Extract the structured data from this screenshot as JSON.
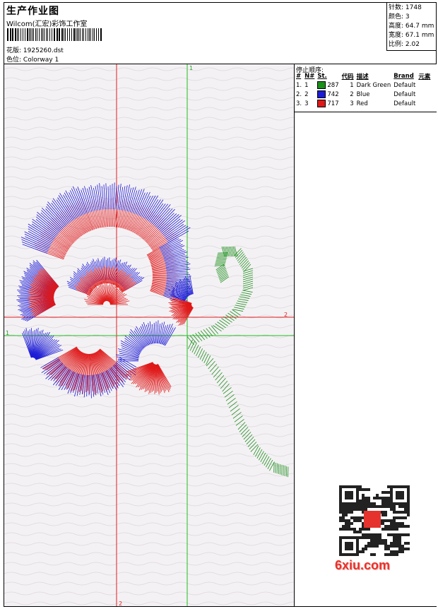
{
  "header": {
    "title": "生产作业图",
    "company": "Wilcom(汇宏)彩饰工作室",
    "pattern_label": "花版:",
    "pattern_value": "1925260.dst",
    "color_label": "色位:",
    "color_value": "Colorway 1"
  },
  "stats": [
    {
      "label": "针数:",
      "value": "1748"
    },
    {
      "label": "颜色:",
      "value": "3"
    },
    {
      "label": "高度:",
      "value": "64.7 mm"
    },
    {
      "label": "宽度:",
      "value": "67.1 mm"
    },
    {
      "label": "比例:",
      "value": "2.02"
    }
  ],
  "stop_sequence": {
    "title": "停止顺序:",
    "columns": [
      "#",
      "N#",
      "St.",
      "代码",
      "描述",
      "Brand",
      "元素"
    ],
    "rows": [
      {
        "index": "1.",
        "n": "1",
        "stitches": "287",
        "code": "1",
        "desc": "Dark Green",
        "brand": "Default",
        "color": "#1a8f1a"
      },
      {
        "index": "2.",
        "n": "2",
        "stitches": "742",
        "code": "2",
        "desc": "Blue",
        "brand": "Default",
        "color": "#1c1cd6"
      },
      {
        "index": "3.",
        "n": "3",
        "stitches": "717",
        "code": "3",
        "desc": "Red",
        "brand": "Default",
        "color": "#e01818"
      }
    ]
  },
  "axis_labels": {
    "green_v": "1",
    "green_h": "1",
    "red_h": "2",
    "red_v": "2"
  },
  "watermark": {
    "site": "6xiu.com"
  }
}
